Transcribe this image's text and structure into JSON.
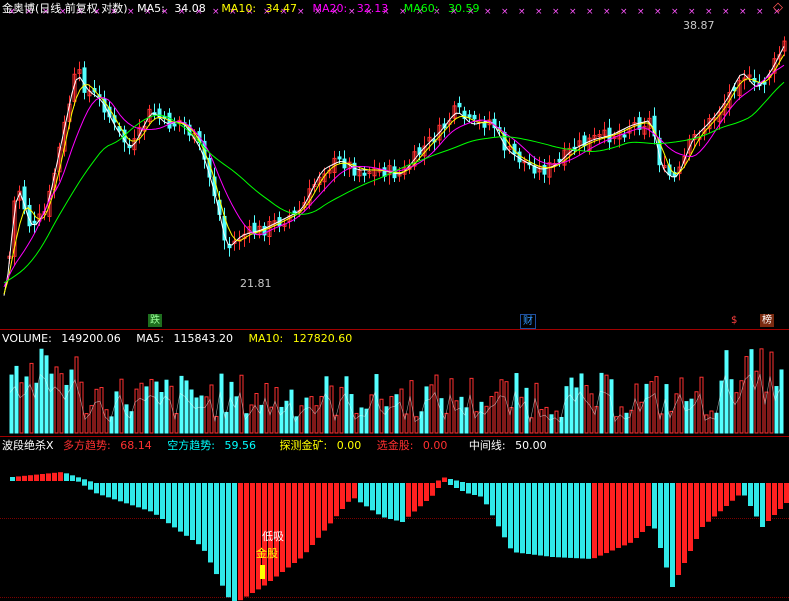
{
  "price_panel": {
    "stock_name": "金奥博",
    "chart_mode": "(日线 前复权 对数)",
    "ma5": {
      "label": "MA5:",
      "value": "34.08",
      "color": "#ffffff"
    },
    "ma10": {
      "label": "MA10:",
      "value": "34.47",
      "color": "#ffff00"
    },
    "ma20": {
      "label": "MA20:",
      "value": "32.13",
      "color": "#ff00ff"
    },
    "ma60": {
      "label": "MA60:",
      "value": "30.59",
      "color": "#00ff00"
    },
    "high_marker": "38.87",
    "low_marker": "21.81",
    "badges": {
      "die": "跌",
      "cai": "财",
      "dollar": "$",
      "bang": "榜"
    },
    "diamond_icon": "diamond-icon",
    "up_color": "#ff3232",
    "down_color": "#54ffff"
  },
  "volume_panel": {
    "volume": {
      "label": "VOLUME:",
      "value": "149200.06"
    },
    "ma5": {
      "label": "MA5:",
      "value": "115843.20"
    },
    "ma10": {
      "label": "MA10:",
      "value": "127820.60"
    }
  },
  "indicator_panel": {
    "name": "波段绝杀X",
    "bull": {
      "label": "多方趋势:",
      "value": "68.14",
      "color": "#ff3030"
    },
    "bear": {
      "label": "空方趋势:",
      "value": "59.56",
      "color": "#00ffff"
    },
    "probe": {
      "label": "探测金矿:",
      "value": "0.00",
      "color": "#ffff00"
    },
    "pick": {
      "label": "选金股:",
      "value": "0.00",
      "color": "#ff3030"
    },
    "mid": {
      "label": "中间线:",
      "value": "50.00",
      "color": "#ffffff"
    },
    "low_buy": "低吸",
    "gold_stock": "金股"
  }
}
